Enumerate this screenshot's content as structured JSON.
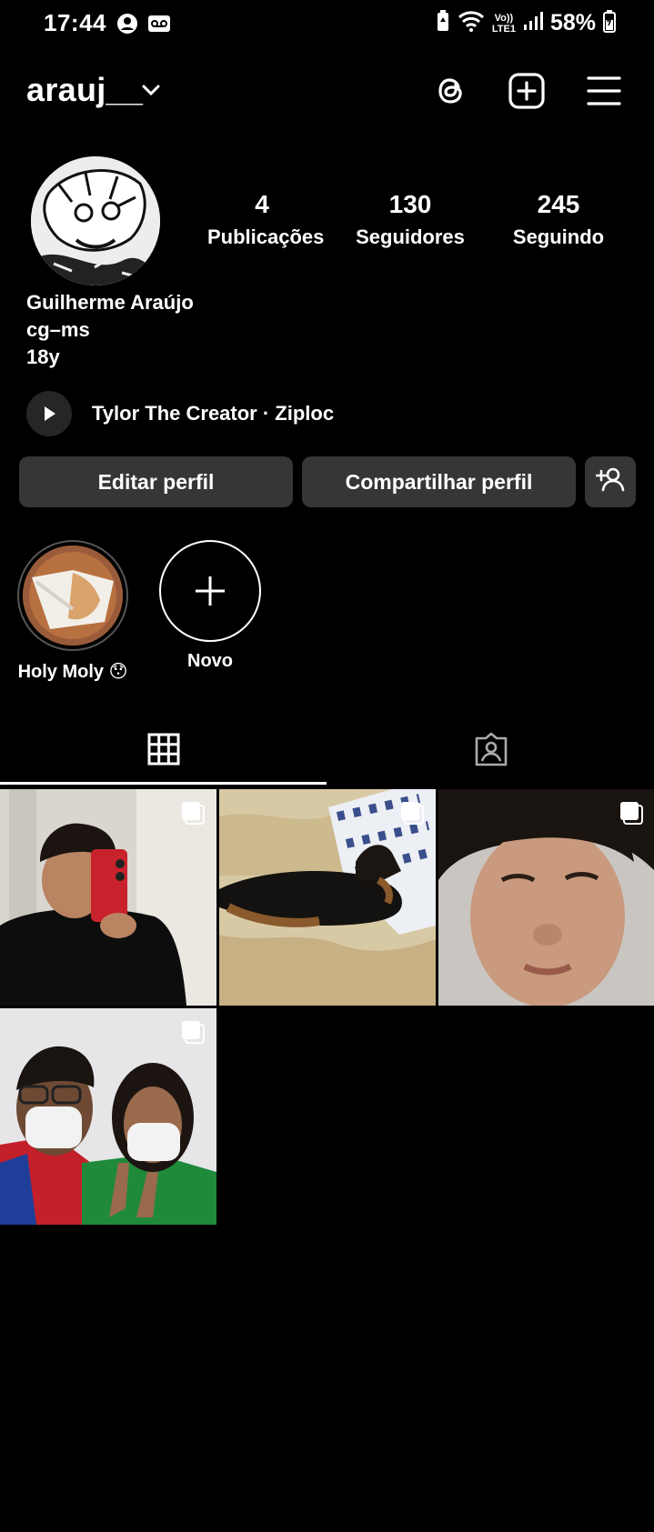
{
  "status_bar": {
    "time": "17:44",
    "network_labels": [
      "Vo))",
      "LTE1"
    ],
    "battery": "58%",
    "icons": [
      "account-circle-icon",
      "voicemail-icon",
      "battery-saver-icon",
      "wifi-icon",
      "volte-icon",
      "signal-icon",
      "battery-icon"
    ]
  },
  "header": {
    "username": "arauj__",
    "icons": [
      "chevron-down-icon",
      "threads-icon",
      "add-post-icon",
      "menu-icon"
    ]
  },
  "profile": {
    "stats": [
      {
        "value": "4",
        "label": "Publicações"
      },
      {
        "value": "130",
        "label": "Seguidores"
      },
      {
        "value": "245",
        "label": "Seguindo"
      }
    ],
    "name": "Guilherme Araújo",
    "bio_lines": [
      "cg–ms",
      "18y"
    ],
    "music": "Tylor The Creator · Ziploc"
  },
  "actions": {
    "edit": "Editar perfil",
    "share": "Compartilhar perfil"
  },
  "highlights": [
    {
      "label": "Holy Moly 😯"
    },
    {
      "label": "Novo"
    }
  ],
  "tabs": [
    "grid-icon",
    "tagged-icon"
  ],
  "posts": [
    {
      "desc": "mirror selfie",
      "multi": true
    },
    {
      "desc": "sleeping dog",
      "multi": true
    },
    {
      "desc": "face closeup",
      "multi": true
    },
    {
      "desc": "selfie with masks",
      "multi": true
    }
  ],
  "colors": {
    "background": "#000000",
    "button": "#363636",
    "text": "#ffffff"
  }
}
